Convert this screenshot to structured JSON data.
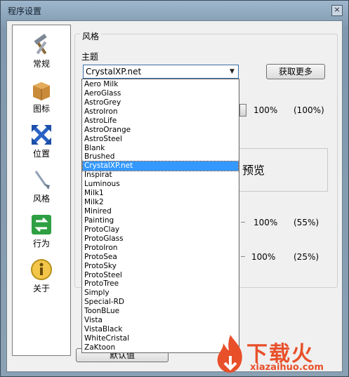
{
  "window": {
    "title": "程序设置",
    "close_label": "×"
  },
  "sidebar": {
    "items": [
      {
        "label": "常规",
        "icon": "hammer-icon"
      },
      {
        "label": "图标",
        "icon": "box-icon"
      },
      {
        "label": "位置",
        "icon": "arrows-icon"
      },
      {
        "label": "风格",
        "icon": "brush-icon"
      },
      {
        "label": "行为",
        "icon": "exchange-icon"
      },
      {
        "label": "关于",
        "icon": "info-icon"
      }
    ]
  },
  "style_group": {
    "title": "风格",
    "theme_label": "主题",
    "theme_selected": "CrystalXP.net",
    "get_more_label": "获取更多",
    "opacity_value": "100%",
    "opacity_paren": "(100%)",
    "preview_label": "预览",
    "row2_value": "100%",
    "row2_paren": "(55%)",
    "row3_value": "100%",
    "row3_paren": "(25%)"
  },
  "bottom": {
    "default_label": "默认值"
  },
  "theme_options": [
    "Aero Milk",
    "AeroGlass",
    "AstroGrey",
    "AstroIron",
    "AstroLife",
    "AstroOrange",
    "AstroSteel",
    "Blank",
    "Brushed",
    "CrystalXP.net",
    "Inspirat",
    "Luminous",
    "Milk1",
    "Milk2",
    "Minired",
    "Painting",
    "ProtoClay",
    "ProtoGlass",
    "ProtoIron",
    "ProtoSea",
    "ProtoSky",
    "ProtoSteel",
    "ProtoTree",
    "Simply",
    "Special-RD",
    "ToonBLue",
    "Vista",
    "VistaBlack",
    "WhiteCristal",
    "ZaKtoon"
  ],
  "selected_index": 9,
  "watermark": {
    "cn": "下载火",
    "en": "xiazaihuo.com"
  }
}
